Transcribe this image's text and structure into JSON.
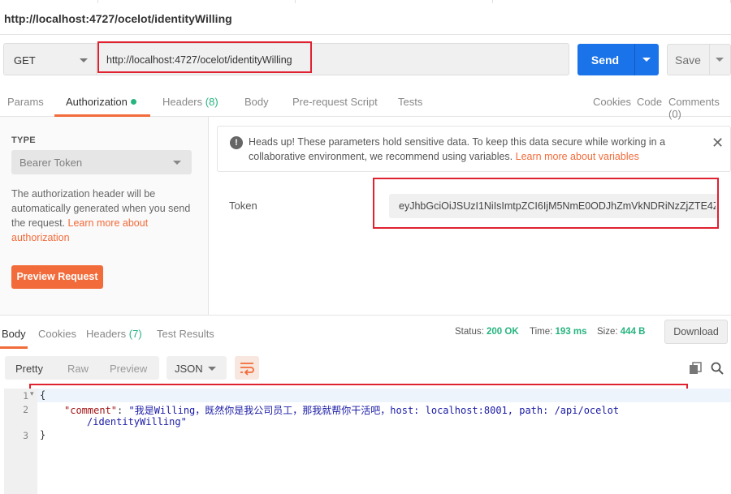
{
  "window": {
    "title": "http://localhost:4727/ocelot/identityWilling"
  },
  "request": {
    "method": "GET",
    "url": "http://localhost:4727/ocelot/identityWilling",
    "send_label": "Send",
    "save_label": "Save"
  },
  "request_tabs": {
    "params": "Params",
    "authorization": "Authorization",
    "headers": "Headers",
    "headers_count": "(8)",
    "body": "Body",
    "prerequest": "Pre-request Script",
    "tests": "Tests",
    "cookies": "Cookies",
    "code": "Code",
    "comments": "Comments (0)"
  },
  "auth": {
    "type_label": "TYPE",
    "type_value": "Bearer Token",
    "description": "The authorization header will be automatically generated when you send the request. ",
    "learn_more": "Learn more about authorization",
    "preview_label": "Preview Request",
    "notice_text": "Heads up! These parameters hold sensitive data. To keep this data secure while working in a collaborative environment, we recommend using variables. ",
    "notice_link": "Learn more about variables",
    "token_label": "Token",
    "token_value": "eyJhbGciOiJSUzI1NiIsImtpZCI6IjM5NmE0ODJhZmVkNDRiNzZjZTE4Z..."
  },
  "response_tabs": {
    "body": "Body",
    "cookies": "Cookies",
    "headers": "Headers",
    "headers_count": "(7)",
    "test_results": "Test Results"
  },
  "response_meta": {
    "status_label": "Status:",
    "status_value": "200 OK",
    "time_label": "Time:",
    "time_value": "193 ms",
    "size_label": "Size:",
    "size_value": "444 B",
    "download_label": "Download"
  },
  "viewer": {
    "modes": [
      "Pretty",
      "Raw",
      "Preview"
    ],
    "format": "JSON"
  },
  "response_body": {
    "line_numbers": [
      "1",
      "2",
      "3"
    ],
    "open_brace": "{",
    "key": "\"comment\"",
    "colon": ": ",
    "value_line1": "\"我是Willing，既然你是我公司员工，那我就帮你干活吧，host: localhost:8001, path: /api/ocelot",
    "value_line2": "/identityWilling\"",
    "close_brace": "}"
  },
  "colors": {
    "accent": "#f26b3a",
    "send_blue": "#1a73e8",
    "status_green": "#26b47f",
    "highlight_red": "#e0212f"
  }
}
